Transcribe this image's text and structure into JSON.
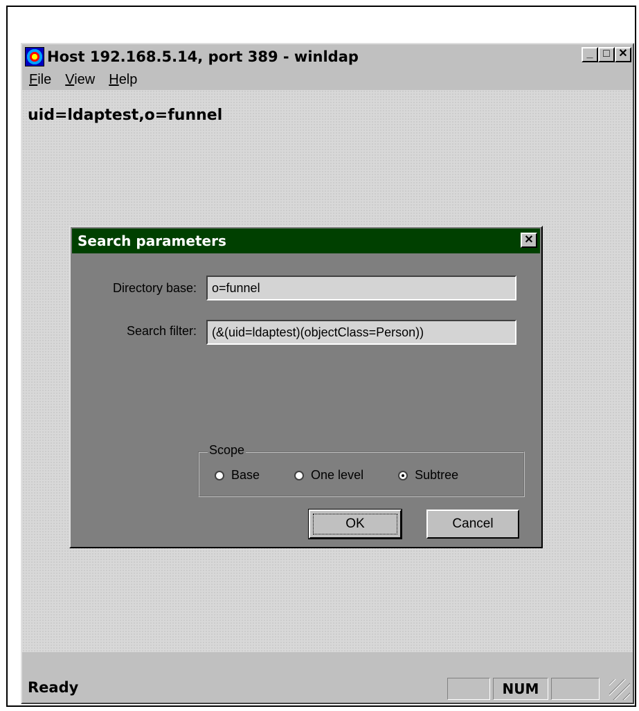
{
  "window": {
    "title": "Host 192.168.5.14, port 389 - winldap",
    "minimize": "_",
    "maximize": "□",
    "close": "✕"
  },
  "menu": {
    "items": [
      {
        "label": "File",
        "accel": "F",
        "rest": "ile"
      },
      {
        "label": "View",
        "accel": "V",
        "rest": "iew"
      },
      {
        "label": "Help",
        "accel": "H",
        "rest": "elp"
      }
    ]
  },
  "content": {
    "dn": "uid=ldaptest,o=funnel"
  },
  "dialog": {
    "title": "Search parameters",
    "close": "✕",
    "directory_base_label": "Directory base:",
    "directory_base_value": "o=funnel",
    "search_filter_label": "Search filter:",
    "search_filter_value": "(&(uid=ldaptest)(objectClass=Person))",
    "scope": {
      "label": "Scope",
      "options": [
        {
          "label": "Base",
          "checked": false
        },
        {
          "label": "One level",
          "checked": false
        },
        {
          "label": "Subtree",
          "checked": true
        }
      ]
    },
    "ok_label": "OK",
    "cancel_label": "Cancel"
  },
  "status": {
    "text": "Ready",
    "num": "NUM"
  }
}
